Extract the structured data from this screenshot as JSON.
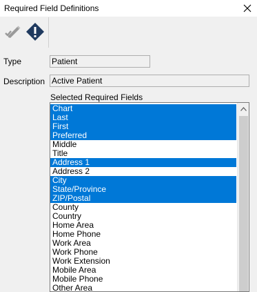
{
  "window": {
    "title": "Required Field Definitions",
    "close_glyph": "✕"
  },
  "toolbar": {
    "edit_icon": "pencil-check-icon",
    "required_icon": "diamond-exclamation-icon"
  },
  "form": {
    "type_label": "Type",
    "type_value": "Patient",
    "description_label": "Description",
    "description_value": "Active Patient",
    "list_label": "Selected Required Fields"
  },
  "list": {
    "items": [
      {
        "label": "Chart",
        "selected": true
      },
      {
        "label": "Last",
        "selected": true
      },
      {
        "label": "First",
        "selected": true
      },
      {
        "label": "Preferred",
        "selected": true
      },
      {
        "label": "Middle",
        "selected": false
      },
      {
        "label": "Title",
        "selected": false
      },
      {
        "label": "Address 1",
        "selected": true
      },
      {
        "label": "Address 2",
        "selected": false
      },
      {
        "label": "City",
        "selected": true
      },
      {
        "label": "State/Province",
        "selected": true
      },
      {
        "label": "ZIP/Postal",
        "selected": true
      },
      {
        "label": "County",
        "selected": false
      },
      {
        "label": "Country",
        "selected": false
      },
      {
        "label": "Home Area",
        "selected": false
      },
      {
        "label": "Home Phone",
        "selected": false
      },
      {
        "label": "Work Area",
        "selected": false
      },
      {
        "label": "Work Phone",
        "selected": false
      },
      {
        "label": "Work Extension",
        "selected": false
      },
      {
        "label": "Mobile Area",
        "selected": false
      },
      {
        "label": "Mobile Phone",
        "selected": false
      },
      {
        "label": "Other Area",
        "selected": false
      }
    ]
  },
  "colors": {
    "selection": "#0078d7",
    "icon_navy": "#1f3a5f"
  }
}
